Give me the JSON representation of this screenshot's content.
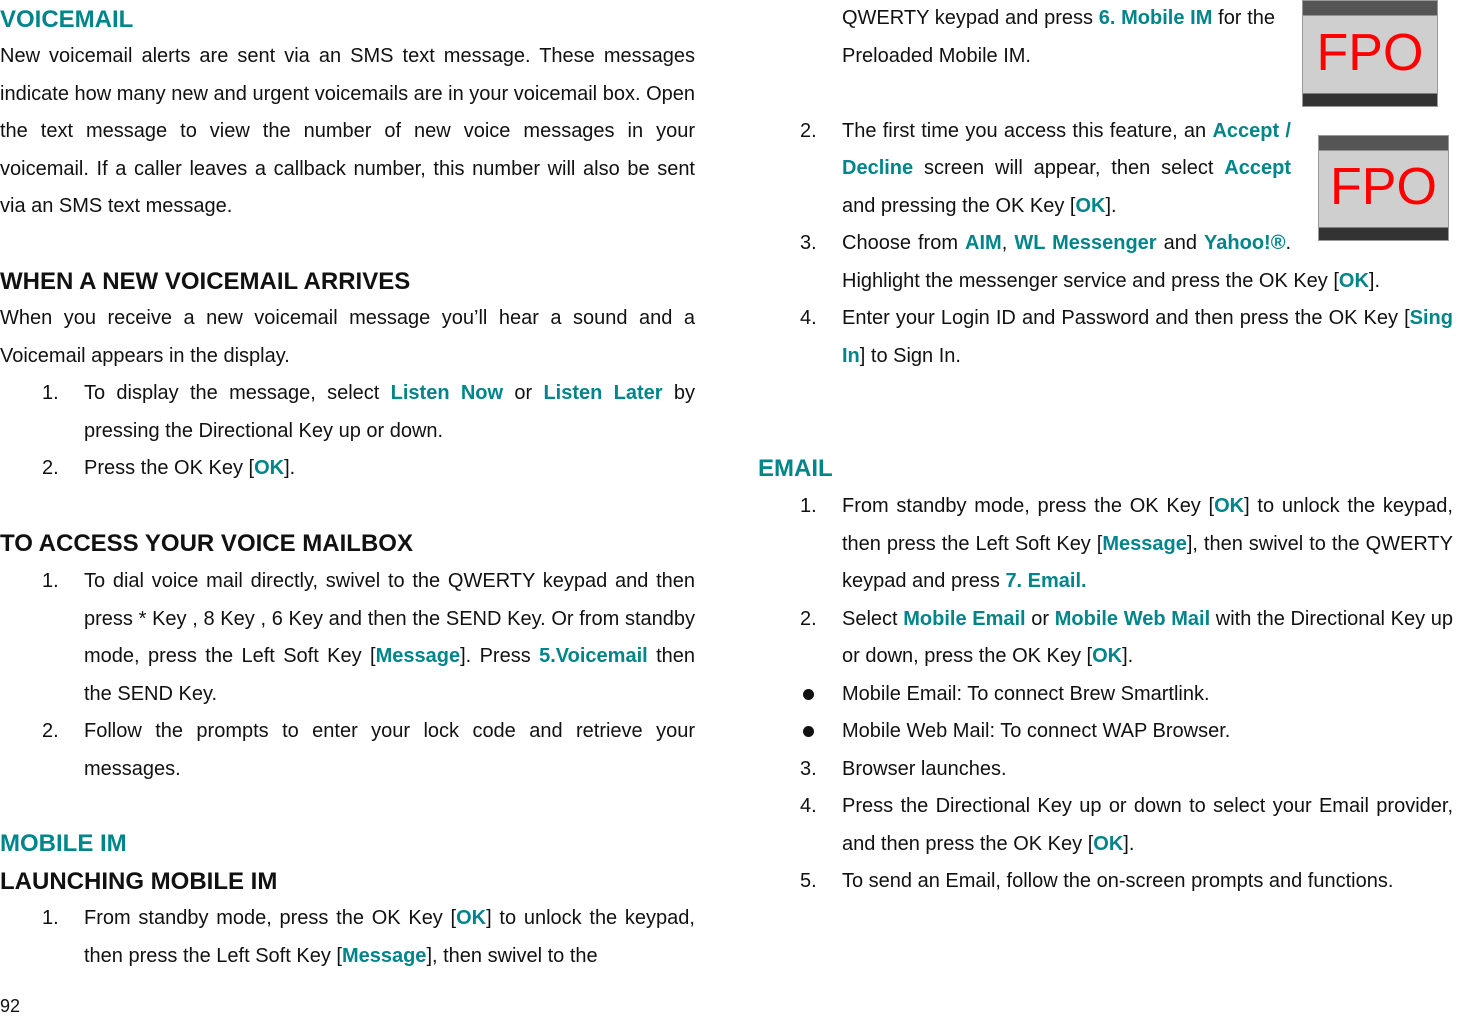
{
  "voicemail": {
    "title": "VOICEMAIL",
    "body": [
      {
        "t": "New voicemail alerts are sent via an SMS text message. These messages indicate how many new and urgent voicemails are in your voicemail box. Open the text message to view the number of new voice messages in your voicemail. If a caller leaves a callback number, this number will also be sent via an SMS text message."
      }
    ]
  },
  "new_voicemail": {
    "title": "WHEN A NEW VOICEMAIL ARRIVES",
    "body": [
      {
        "t": "When you receive a new voicemail message you’ll hear a sound and a Voicemail appears in the display."
      }
    ],
    "steps": [
      {
        "num": "1.",
        "segs": [
          {
            "t": "To display the message, select "
          },
          {
            "t": "Listen Now",
            "hl": true
          },
          {
            "t": " or "
          },
          {
            "t": "Listen Later",
            "hl": true
          },
          {
            "t": " by pressing the Directional Key up or down."
          }
        ]
      },
      {
        "num": "2.",
        "segs": [
          {
            "t": "Press the OK Key ["
          },
          {
            "t": "OK",
            "hl": true
          },
          {
            "t": "]."
          }
        ]
      }
    ]
  },
  "access_mailbox": {
    "title": "TO ACCESS YOUR VOICE MAILBOX",
    "steps": [
      {
        "num": "1.",
        "segs": [
          {
            "t": "To dial voice mail directly, swivel to the QWERTY keypad and then press * Key , 8 Key , 6 Key and then the SEND Key. Or from standby mode, press the Left Soft Key ["
          },
          {
            "t": "Message",
            "hl": true
          },
          {
            "t": "]. Press "
          },
          {
            "t": "5.Voicemail",
            "hl": true
          },
          {
            "t": " then the SEND Key."
          }
        ]
      },
      {
        "num": "2.",
        "segs": [
          {
            "t": "Follow the prompts to enter your lock code and retrieve your messages."
          }
        ]
      }
    ]
  },
  "mobile_im": {
    "title": "MOBILE IM",
    "subtitle": "LAUNCHING MOBILE IM",
    "steps": [
      {
        "num": "1.",
        "segs": [
          {
            "t": "From standby mode, press the OK Key ["
          },
          {
            "t": "OK",
            "hl": true
          },
          {
            "t": "] to unlock the keypad, then press the Left Soft Key ["
          },
          {
            "t": "Message",
            "hl": true
          },
          {
            "t": "], then swivel to the"
          }
        ]
      }
    ],
    "continued": [
      {
        "t": "QWERTY keypad and press "
      },
      {
        "t": "6. Mobile IM",
        "hl": true
      },
      {
        "t": " for the Preloaded Mobile IM."
      }
    ],
    "steps2": [
      {
        "num": "2.",
        "segs": [
          {
            "t": "The first time you access this feature, an "
          },
          {
            "t": "Accept / Decline",
            "hl": true
          },
          {
            "t": " screen will appear, then select "
          },
          {
            "t": "Accept",
            "hl": true
          },
          {
            "t": " and pressing the OK Key ["
          },
          {
            "t": "OK",
            "hl": true
          },
          {
            "t": "]."
          }
        ]
      },
      {
        "num": "3.",
        "segs": [
          {
            "t": "Choose from "
          },
          {
            "t": "AIM",
            "hl": true
          },
          {
            "t": ", "
          },
          {
            "t": "WL Messenger",
            "hl": true
          },
          {
            "t": " and "
          },
          {
            "t": "Yahoo!®",
            "hl": true
          },
          {
            "t": ". Highlight the messenger service and press the OK Key ["
          },
          {
            "t": "OK",
            "hl": true
          },
          {
            "t": "]."
          }
        ]
      },
      {
        "num": "4.",
        "segs": [
          {
            "t": "Enter your Login ID and Password and then press the OK Key ["
          },
          {
            "t": "Sing In",
            "hl": true
          },
          {
            "t": "] to Sign In."
          }
        ]
      }
    ],
    "image_placeholder": "FPO"
  },
  "email": {
    "title": "EMAIL",
    "steps": [
      {
        "num": "1.",
        "segs": [
          {
            "t": "From standby mode, press the OK Key ["
          },
          {
            "t": "OK",
            "hl": true
          },
          {
            "t": "] to unlock the keypad, then press the Left Soft Key ["
          },
          {
            "t": "Message",
            "hl": true
          },
          {
            "t": "], then swivel to the QWERTY keypad and press "
          },
          {
            "t": "7. Email.",
            "hl": true
          }
        ]
      },
      {
        "num": "2.",
        "segs": [
          {
            "t": "Select "
          },
          {
            "t": "Mobile Email",
            "hl": true
          },
          {
            "t": " or "
          },
          {
            "t": "Mobile Web Mail",
            "hl": true
          },
          {
            "t": " with the Directional Key up or down, press the OK Key ["
          },
          {
            "t": "OK",
            "hl": true
          },
          {
            "t": "]."
          }
        ],
        "bullets": [
          "Mobile Email: To connect Brew Smartlink.",
          "Mobile Web Mail: To connect WAP Browser."
        ]
      },
      {
        "num": "3.",
        "segs": [
          {
            "t": "Browser launches."
          }
        ]
      },
      {
        "num": "4.",
        "segs": [
          {
            "t": "Press the Directional Key up or down to select your Email provider, and then press the OK Key ["
          },
          {
            "t": "OK",
            "hl": true
          },
          {
            "t": "]."
          }
        ]
      },
      {
        "num": "5.",
        "segs": [
          {
            "t": "To send an Email, follow the on-screen prompts and functions."
          }
        ]
      }
    ]
  },
  "page_number": "92",
  "colors": {
    "accent": "#00858a",
    "fpo": "#ff0000"
  }
}
